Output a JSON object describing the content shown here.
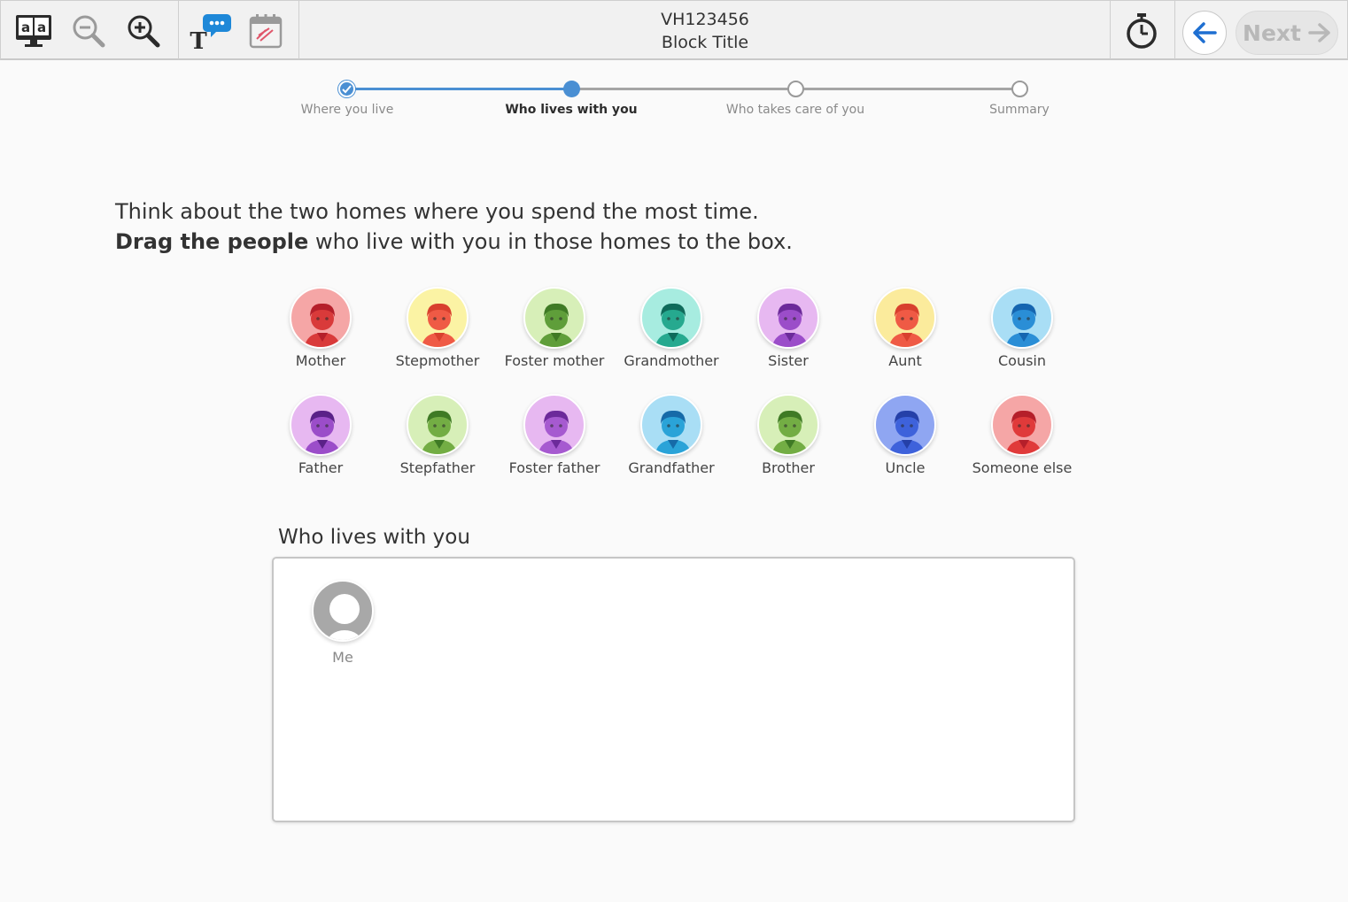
{
  "header": {
    "code": "VH123456",
    "block_title": "Block Title",
    "next_label": "Next"
  },
  "toolbar": {
    "tools": [
      "text-to-speech-icon",
      "zoom-out-icon",
      "zoom-in-icon",
      "annotate-icon",
      "calendar-icon"
    ],
    "timer": "timer-icon",
    "back": "back-arrow-icon"
  },
  "progress": {
    "steps": [
      {
        "label": "Where you live",
        "state": "done"
      },
      {
        "label": "Who lives with you",
        "state": "current"
      },
      {
        "label": "Who takes care of you",
        "state": "todo"
      },
      {
        "label": "Summary",
        "state": "todo"
      }
    ],
    "accent": "#4a8fd3"
  },
  "instructions": {
    "line1": "Think about the two homes where you spend the most time.",
    "line2_bold": "Drag the people",
    "line2_rest": " who live with you in those homes to the box."
  },
  "people": [
    {
      "name": "Mother",
      "bg": "#f5a6a6",
      "fg": "#d93a3a",
      "hair": "#b51f2a"
    },
    {
      "name": "Stepmother",
      "bg": "#fbf3a4",
      "fg": "#ef5a45",
      "hair": "#d8402e"
    },
    {
      "name": "Foster mother",
      "bg": "#d7efb8",
      "fg": "#5f9e3a",
      "hair": "#3f7a25"
    },
    {
      "name": "Grandmother",
      "bg": "#a7ece0",
      "fg": "#26a98f",
      "hair": "#0f6b5b"
    },
    {
      "name": "Sister",
      "bg": "#e7b8f1",
      "fg": "#9b4dc9",
      "hair": "#6c2a9a"
    },
    {
      "name": "Aunt",
      "bg": "#fbeb9c",
      "fg": "#ef5a45",
      "hair": "#d8402e"
    },
    {
      "name": "Cousin",
      "bg": "#a9def5",
      "fg": "#2a8ed6",
      "hair": "#1565b0"
    },
    {
      "name": "Father",
      "bg": "#e7b8f1",
      "fg": "#9b4dc9",
      "hair": "#5a2188"
    },
    {
      "name": "Stepfather",
      "bg": "#d7efb8",
      "fg": "#73ad44",
      "hair": "#3f7a25"
    },
    {
      "name": "Foster father",
      "bg": "#e7b8f1",
      "fg": "#a65ad0",
      "hair": "#6c2a9a"
    },
    {
      "name": "Grandfather",
      "bg": "#a9def5",
      "fg": "#2aa3d8",
      "hair": "#166aa8"
    },
    {
      "name": "Brother",
      "bg": "#d7efb8",
      "fg": "#73ad44",
      "hair": "#3f7a25"
    },
    {
      "name": "Uncle",
      "bg": "#8fa6f2",
      "fg": "#3e62db",
      "hair": "#2540a8"
    },
    {
      "name": "Someone else",
      "bg": "#f5a6a6",
      "fg": "#e03a3a",
      "hair": "#b51f2a"
    }
  ],
  "drop_box": {
    "title": "Who lives with you",
    "items": [
      {
        "name": "Me"
      }
    ]
  }
}
